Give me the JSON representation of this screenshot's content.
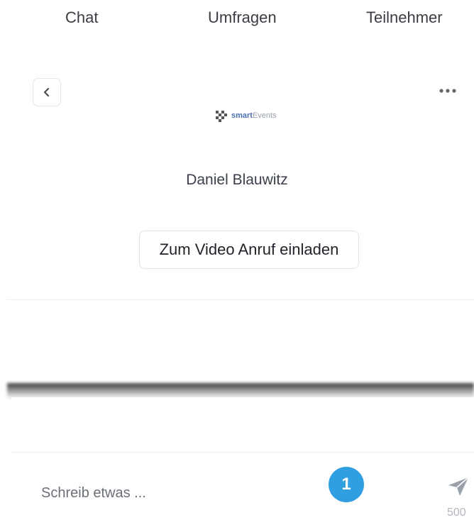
{
  "tabs": [
    {
      "label": "Chat"
    },
    {
      "label": "Umfragen"
    },
    {
      "label": "Teilnehmer"
    }
  ],
  "header": {
    "back_icon": "chevron-left-icon",
    "more_icon": "ellipsis-icon"
  },
  "logo": {
    "strong": "smart",
    "light": "Events"
  },
  "contact": {
    "name": "Daniel Blauwitz"
  },
  "actions": {
    "invite_label": "Zum Video Anruf einladen"
  },
  "composer": {
    "placeholder": "Schreib etwas ...",
    "badge": "1",
    "char_count": "500",
    "send_icon": "paper-plane-icon"
  },
  "colors": {
    "badge": "#2f9fe2",
    "send_icon": "#9aa0a8"
  }
}
